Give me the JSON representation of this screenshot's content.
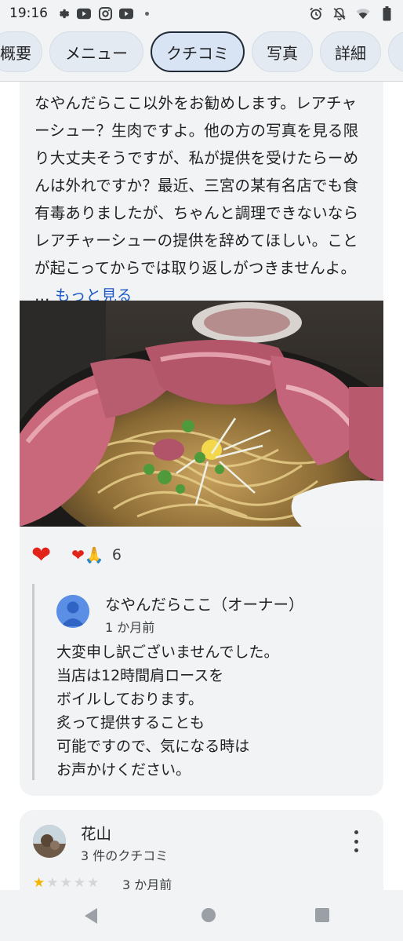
{
  "status_bar": {
    "time": "19:16",
    "left_icons": [
      "gear-icon",
      "youtube-icon",
      "instagram-icon",
      "youtube-icon",
      "dot-icon"
    ],
    "right_icons": [
      "alarm-icon",
      "bell-off-icon",
      "wifi-icon",
      "battery-icon"
    ]
  },
  "tabs": [
    {
      "label": "概要",
      "active": false
    },
    {
      "label": "メニュー",
      "active": false
    },
    {
      "label": "クチコミ",
      "active": true
    },
    {
      "label": "写真",
      "active": false
    },
    {
      "label": "詳細",
      "active": false
    }
  ],
  "review": {
    "text": "なやんだらここ以外をお勧めします。レアチャーシュー？生肉ですよ。他の方の写真を見る限り大丈夫そうですが、私が提供を受けたらーめんは外れですか？最近、三宮の某有名店でも食有毒ありましたが、ちゃんと調理できないならレアチャーシューの提供を辞めてほしい。ことが起こってからでは取り返しがつきませんよ。",
    "ellipsis": " … ",
    "more_label": "もっと見る",
    "reaction_count": "6"
  },
  "owner_reply": {
    "name": "なやんだらここ（オーナー）",
    "time": "1 か月前",
    "text": "大変申し訳ございませんでした。\n当店は12時間肩ロースを\nボイルしております。\n炙って提供することも\n可能ですので、気になる時は\nお声かけください。"
  },
  "next_review": {
    "name": "花山",
    "review_count": "3 件のクチコミ",
    "rating": 1,
    "time": "3 か月前"
  },
  "colors": {
    "accent_link": "#1a57c7",
    "heart": "#e2231a",
    "star_on": "#f4b400",
    "card_bg": "#f1f3f4"
  }
}
